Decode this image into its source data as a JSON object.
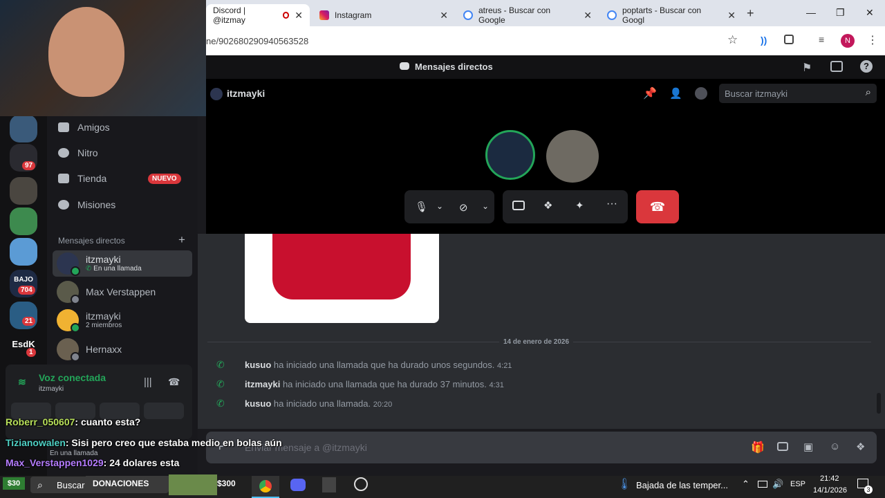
{
  "browser": {
    "tabs": [
      {
        "label": "Discord | @itzmay",
        "active": true
      },
      {
        "label": "Instagram",
        "active": false
      },
      {
        "label": "atreus - Buscar con Google",
        "active": false
      },
      {
        "label": "poptarts - Buscar con Googl",
        "active": false
      }
    ],
    "url": "ne/902680290940563528",
    "profile_initial": "N"
  },
  "discord": {
    "top_title": "Mensajes directos",
    "channel_name": "itzmayki",
    "search_placeholder": "Buscar itzmayki",
    "nav": [
      {
        "label": "Amigos",
        "icon": "friends-icon"
      },
      {
        "label": "Nitro",
        "icon": "nitro-icon"
      },
      {
        "label": "Tienda",
        "icon": "shop-icon",
        "badge": "NUEVO"
      },
      {
        "label": "Misiones",
        "icon": "quests-icon"
      }
    ],
    "dm_header": "Mensajes directos",
    "dms": [
      {
        "name": "itzmayki",
        "sub": "En una llamada",
        "selected": true
      },
      {
        "name": "Max Verstappen",
        "sub": ""
      },
      {
        "name": "itzmayki",
        "sub": "2 miembros"
      },
      {
        "name": "Hernaxx",
        "sub": ""
      }
    ],
    "server_badges": [
      "97",
      "704",
      "21",
      "1"
    ],
    "server_labels": [
      "BAJO",
      "EsdK"
    ],
    "voice": {
      "status": "Voz conectada",
      "channel": "itzmayki"
    },
    "user_panel": {
      "status": "En una llamada"
    },
    "chat": {
      "date_divider": "14 de enero de 2026",
      "messages": [
        {
          "user": "kusuo",
          "text": "ha iniciado una llamada que ha durado unos segundos.",
          "time": "4:21"
        },
        {
          "user": "itzmayki",
          "text": "ha iniciado una llamada que ha durado 37 minutos.",
          "time": "4:31"
        },
        {
          "user": "kusuo",
          "text": "ha iniciado una llamada.",
          "time": "20:20"
        }
      ],
      "composer_placeholder": "Enviar mensaje a @itzmayki"
    }
  },
  "stream_overlay": [
    {
      "user": "Roberr_050607",
      "text": ": cuanto esta?",
      "color": "#b8e05a"
    },
    {
      "user": "Tizianowalen",
      "text": ": Sisi pero creo que estaba medio en bolas aún",
      "color": "#4fd1c5"
    },
    {
      "user": "Max_Verstappen1029",
      "text": ": 24 dolares esta",
      "color": "#b57cff"
    }
  ],
  "taskbar": {
    "left_badge": "$30",
    "search": "Buscar",
    "donations": "DONACIONES",
    "donation_amount": "$300",
    "weather": "Bajada de las temper...",
    "lang": "ESP",
    "time": "21:42",
    "date": "14/1/2026",
    "notif_count": "3"
  },
  "colors": {
    "discord_red": "#da373c",
    "online": "#23a559",
    "accent": "#5865f2"
  }
}
